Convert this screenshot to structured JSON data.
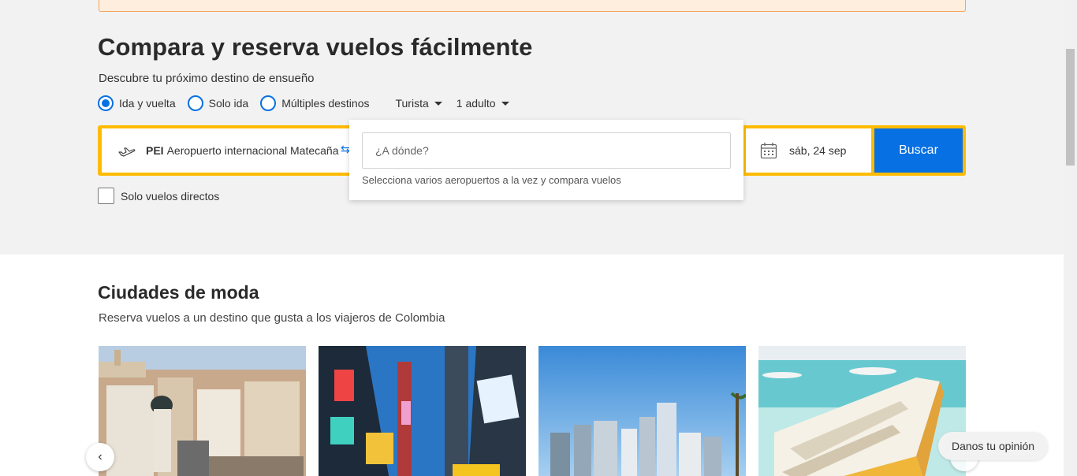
{
  "hero": {
    "title": "Compara y reserva vuelos fácilmente",
    "subtitle": "Descubre tu próximo destino de ensueño"
  },
  "trip_types": [
    {
      "label": "Ida y vuelta",
      "selected": true
    },
    {
      "label": "Solo ida",
      "selected": false
    },
    {
      "label": "Múltiples destinos",
      "selected": false
    }
  ],
  "cabin_class": "Turista",
  "passengers": "1 adulto",
  "origin": {
    "code": "PEI",
    "name": "Aeropuerto internacional Matecaña"
  },
  "destination": {
    "placeholder": "¿A dónde?",
    "hint": "Selecciona varios aeropuertos a la vez y compara vuelos"
  },
  "date": "sáb, 24 sep",
  "search_label": "Buscar",
  "direct_flights_label": "Solo vuelos directos",
  "trending": {
    "title": "Ciudades de moda",
    "subtitle": "Reserva vuelos a un destino que gusta a los viajeros de Colombia"
  },
  "carousel": {
    "prev_icon": "‹"
  },
  "feedback_label": "Danos tu opinión",
  "colors": {
    "brand_blue": "#0770e3",
    "search_yellow": "#febb02",
    "banner_border": "#f5a25d"
  }
}
